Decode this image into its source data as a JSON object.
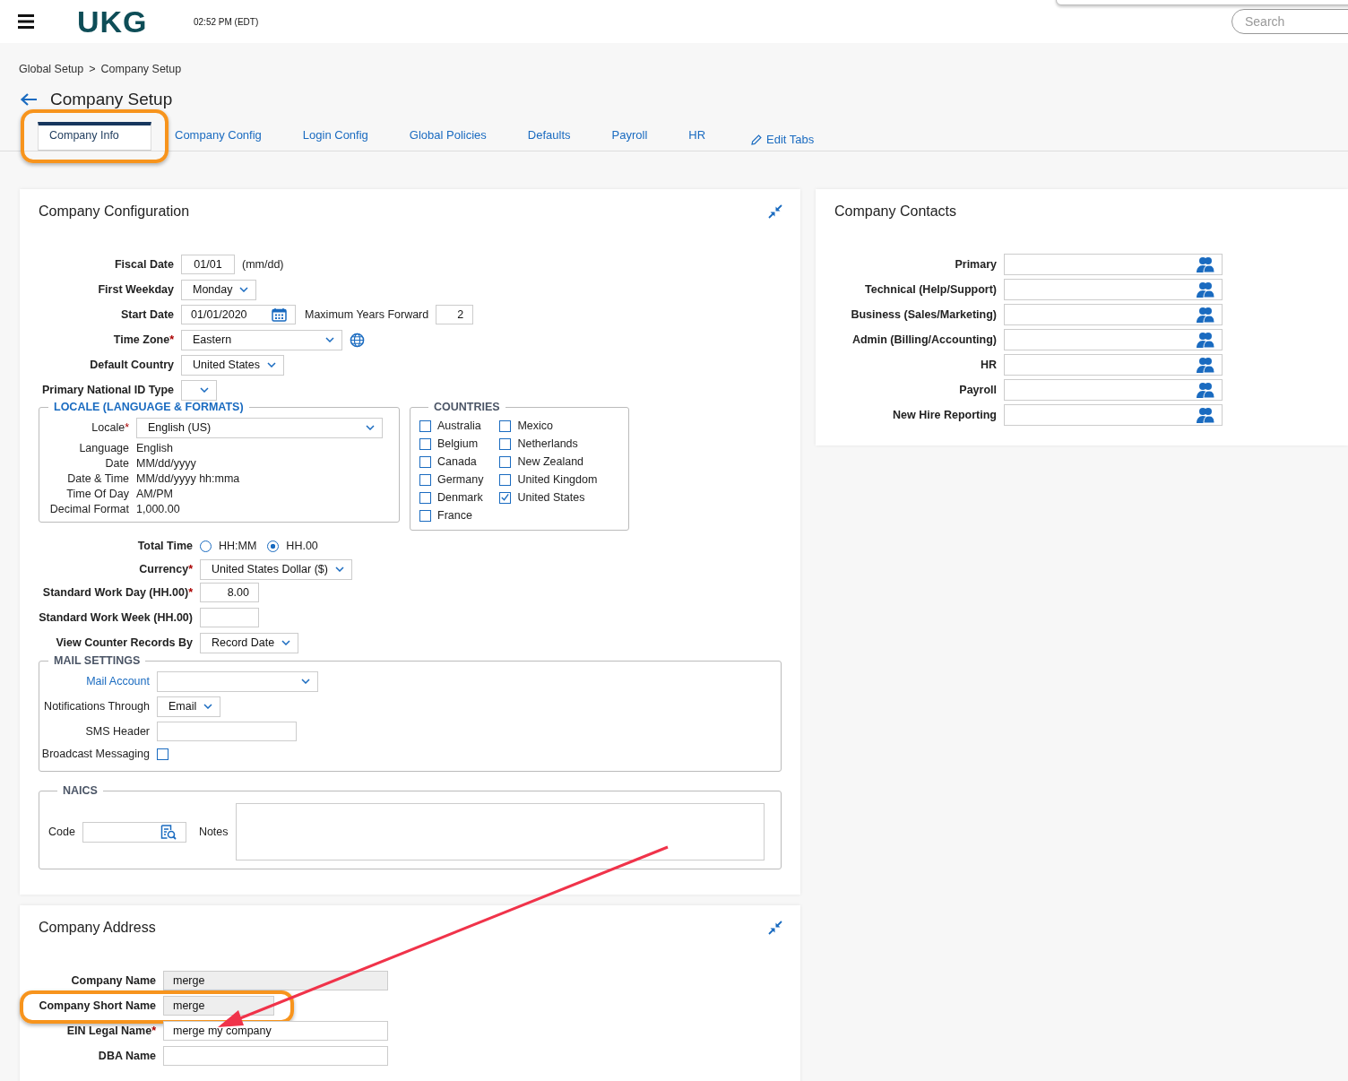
{
  "header": {
    "logo": "UKG",
    "time": "02:52 PM (EDT)",
    "search": {
      "placeholder": "Search"
    }
  },
  "breadcrumb": {
    "items": [
      "Global Setup",
      "Company Setup"
    ],
    "separator": ">"
  },
  "page_title": "Company Setup",
  "tabs": [
    {
      "label": "Company Info",
      "selected": true,
      "highlighted": true
    },
    {
      "label": "Company Config",
      "selected": false,
      "highlighted": false
    },
    {
      "label": "Login Config",
      "selected": false,
      "highlighted": false
    },
    {
      "label": "Global Policies",
      "selected": false,
      "highlighted": false
    },
    {
      "label": "Defaults",
      "selected": false,
      "highlighted": false
    },
    {
      "label": "Payroll",
      "selected": false,
      "highlighted": false
    },
    {
      "label": "HR",
      "selected": false,
      "highlighted": false
    }
  ],
  "edit_tabs": "Edit Tabs",
  "company_configuration": {
    "title": "Company Configuration",
    "fields": [
      {
        "kind": "text",
        "label": "Fiscal Date",
        "value": "01/01",
        "hint": "(mm/dd)"
      },
      {
        "kind": "select",
        "label": "First Weekday",
        "value": "Monday"
      },
      {
        "kind": "date",
        "label": "Start Date",
        "value": "01/01/2020",
        "extra_label": "Maximum Years Forward",
        "extra_value": "2"
      },
      {
        "kind": "select",
        "label": "Time Zone",
        "required_mark": "*",
        "value": "Eastern",
        "wide": true,
        "globe": true
      },
      {
        "kind": "select",
        "label": "Default Country",
        "value": "United States"
      },
      {
        "kind": "select",
        "label": "Primary National ID Type"
      }
    ],
    "locale": {
      "legend": "LOCALE (LANGUAGE & FORMATS)",
      "label": "Locale",
      "required_mark": "*",
      "value": "English (US)",
      "details": [
        {
          "label": "Language",
          "value": "English"
        },
        {
          "label": "Date",
          "value": "MM/dd/yyyy"
        },
        {
          "label": "Date & Time",
          "value": "MM/dd/yyyy hh:mma"
        },
        {
          "label": "Time Of Day",
          "value": "AM/PM"
        },
        {
          "label": "Decimal Format",
          "value": "1,000.00"
        }
      ]
    },
    "countries": {
      "legend": "COUNTRIES",
      "items": [
        {
          "label": "Australia",
          "checked": false
        },
        {
          "label": "Belgium",
          "checked": false
        },
        {
          "label": "Canada",
          "checked": false
        },
        {
          "label": "Germany",
          "checked": false
        },
        {
          "label": "Denmark",
          "checked": false
        },
        {
          "label": "France",
          "checked": false
        },
        {
          "label": "Mexico",
          "checked": false
        },
        {
          "label": "Netherlands",
          "checked": false
        },
        {
          "label": "New Zealand",
          "checked": false
        },
        {
          "label": "United Kingdom",
          "checked": false
        },
        {
          "label": "United States",
          "checked": true
        }
      ]
    },
    "fields_2": [
      {
        "kind": "radio",
        "label": "Total Time",
        "options": [
          {
            "label": "HH:MM",
            "selected": false
          },
          {
            "label": "HH.00",
            "selected": true
          }
        ]
      },
      {
        "kind": "select",
        "label": "Currency",
        "required_mark": "*",
        "value": "United States Dollar ($)"
      },
      {
        "kind": "number",
        "label": "Standard Work Day (HH.00)",
        "required_mark": "*",
        "value": "8.00"
      },
      {
        "kind": "number",
        "label": "Standard Work Week (HH.00)"
      },
      {
        "kind": "select",
        "label": "View Counter Records By",
        "value": "Record Date"
      }
    ],
    "mail_settings": {
      "legend": "MAIL SETTINGS",
      "fields": [
        {
          "kind": "select",
          "label": "Mail Account",
          "link": true,
          "wide": true
        },
        {
          "kind": "select",
          "label": "Notifications Through",
          "value": "Email"
        },
        {
          "kind": "text",
          "label": "SMS Header",
          "wide": true
        },
        {
          "kind": "checkbox",
          "label": "Broadcast Messaging",
          "checked": false
        }
      ]
    },
    "naics": {
      "legend": "NAICS",
      "code_label": "Code",
      "notes_label": "Notes"
    }
  },
  "company_contacts": {
    "title": "Company Contacts",
    "rows": [
      {
        "label": "Primary"
      },
      {
        "label": "Technical (Help/Support)"
      },
      {
        "label": "Business (Sales/Marketing)"
      },
      {
        "label": "Admin (Billing/Accounting)"
      },
      {
        "label": "HR"
      },
      {
        "label": "Payroll"
      },
      {
        "label": "New Hire Reporting"
      }
    ]
  },
  "company_address": {
    "title": "Company Address",
    "fields": [
      {
        "label": "Company Name",
        "readonly": true,
        "value": "merge",
        "highlighted": false,
        "wide": true
      },
      {
        "label": "Company Short Name",
        "readonly": true,
        "value": "merge",
        "highlighted": true,
        "wide": false
      },
      {
        "label": "EIN Legal Name",
        "required_mark": "*",
        "readonly": false,
        "value": "merge my company",
        "highlighted": false,
        "wide": true
      },
      {
        "label": "DBA Name",
        "readonly": false,
        "highlighted": false,
        "wide": true
      }
    ]
  }
}
